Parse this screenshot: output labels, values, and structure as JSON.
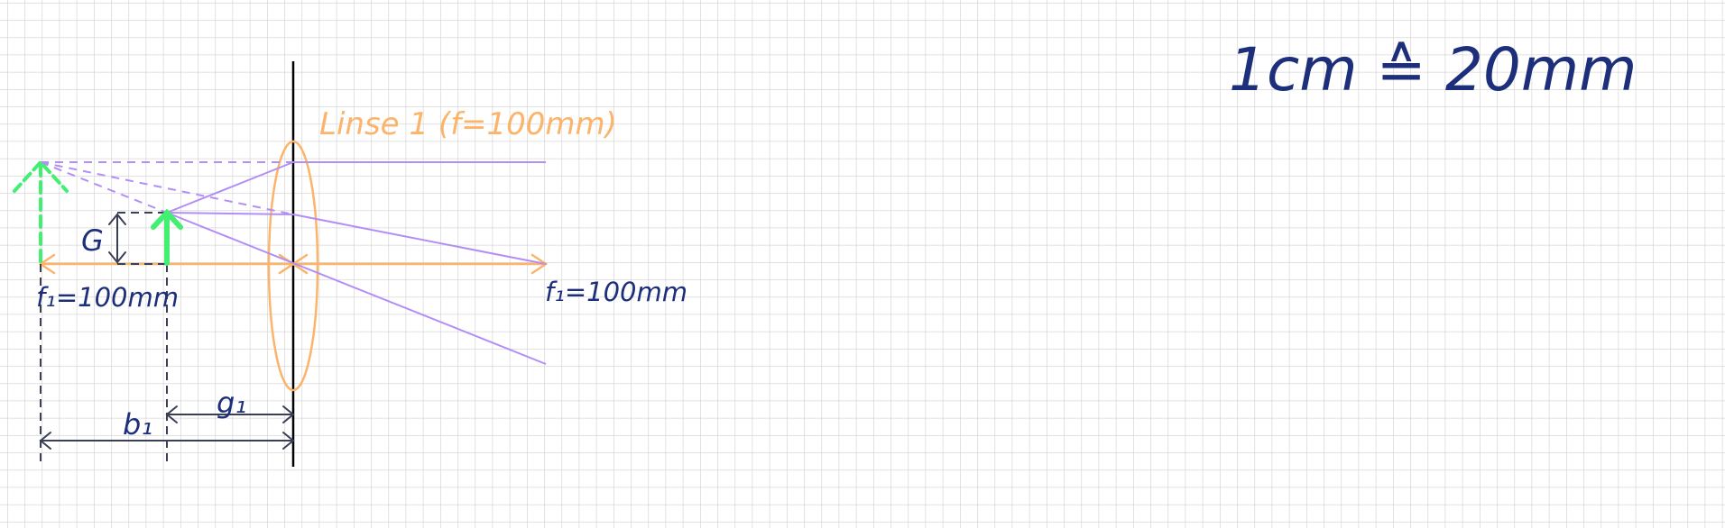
{
  "colors": {
    "grid": "#cfcfcf",
    "optical_axis": "#fbb46a",
    "lens": "#fbb46a",
    "lens_label": "#fbb46a",
    "ray": "#b38ef5",
    "object_arrow": "#41ef71",
    "dimension": "#3b3f56",
    "ink": "#1d2f7a",
    "lens_plane": "#000000"
  },
  "labels": {
    "lens_title": "Linse 1 (f=100mm)",
    "focal_left": "f₁=100mm",
    "focal_right": "f₁=100mm",
    "object_size": "G",
    "object_distance": "g₁",
    "image_distance": "b₁",
    "scale": "1cm ≙ 20mm"
  }
}
